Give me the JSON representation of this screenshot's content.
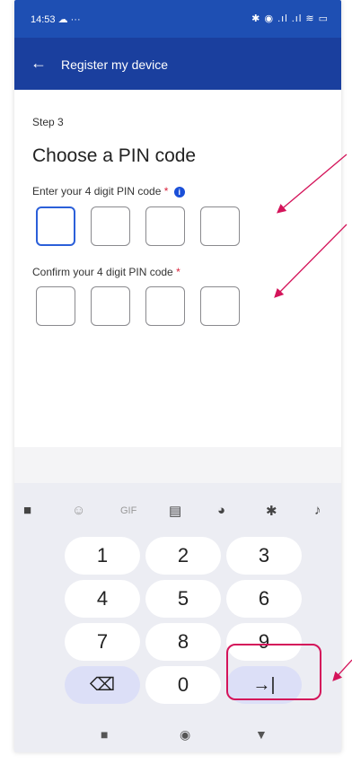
{
  "status_bar": {
    "time": "14:53 ☁ ···",
    "icons": "✱ ◉ .ıl .ıl ≋ ▭"
  },
  "app_bar": {
    "back_glyph": "←",
    "title": "Register my device"
  },
  "form": {
    "step": "Step 3",
    "heading": "Choose a PIN code",
    "pin_label": "Enter your 4 digit PIN code",
    "confirm_label": "Confirm your 4 digit PIN code",
    "required_marker": "*",
    "info_glyph": "i",
    "pin_values": [
      "",
      "",
      "",
      ""
    ],
    "confirm_values": [
      "",
      "",
      "",
      ""
    ]
  },
  "keyboard": {
    "toolbar": [
      {
        "name": "apps-grid-icon",
        "glyph": "■"
      },
      {
        "name": "sticker-icon",
        "glyph": "☺"
      },
      {
        "name": "gif-icon",
        "glyph": "GIF"
      },
      {
        "name": "clipboard-icon",
        "glyph": "▤"
      },
      {
        "name": "palette-icon",
        "glyph": "◕"
      },
      {
        "name": "gear-icon",
        "glyph": "✱"
      },
      {
        "name": "mic-icon",
        "glyph": "♪"
      }
    ],
    "keys": [
      [
        "1",
        "2",
        "3"
      ],
      [
        "4",
        "5",
        "6"
      ],
      [
        "7",
        "8",
        "9"
      ],
      [
        "⌫",
        "0",
        "→|"
      ]
    ]
  },
  "nav_bar": {
    "recents": "■",
    "home": "◉",
    "back": "▼"
  },
  "colors": {
    "app_bar": "#1a3f9e",
    "accent": "#2b5fd9",
    "annotation": "#d4145a",
    "required": "#d9233c"
  }
}
